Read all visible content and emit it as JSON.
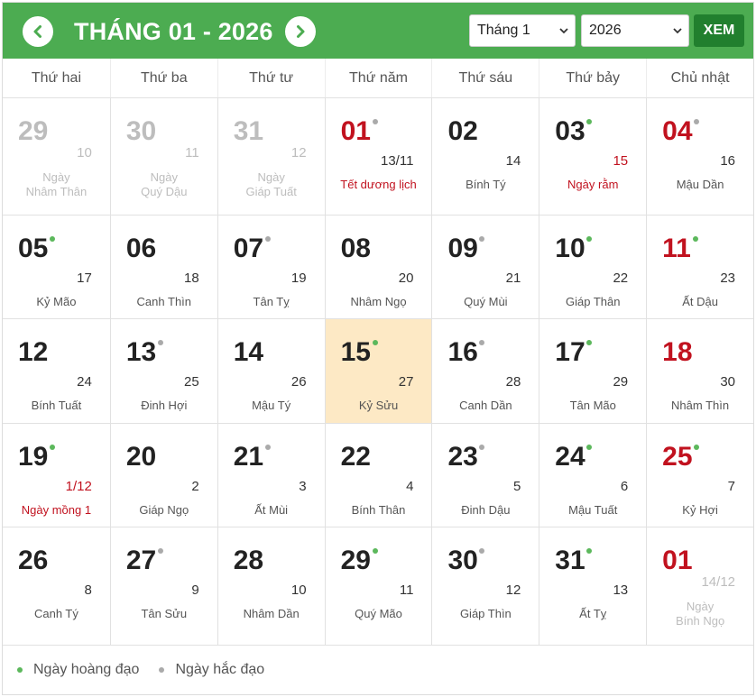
{
  "header": {
    "title": "THÁNG 01 - 2026",
    "month_select": "Tháng 1",
    "year_select": "2026",
    "view_label": "XEM",
    "accent": "#4cac51",
    "button_color": "#217f2e"
  },
  "weekdays": [
    "Thứ hai",
    "Thứ ba",
    "Thứ tư",
    "Thứ năm",
    "Thứ sáu",
    "Thứ bảy",
    "Chủ nhật"
  ],
  "weeks": [
    [
      {
        "day": "29",
        "lunar": "10",
        "canchi": "Ngày\nNhâm Thân",
        "muted": true
      },
      {
        "day": "30",
        "lunar": "11",
        "canchi": "Ngày\nQuý Dậu",
        "muted": true
      },
      {
        "day": "31",
        "lunar": "12",
        "canchi": "Ngày\nGiáp Tuất",
        "muted": true
      },
      {
        "day": "01",
        "lunar": "13/11",
        "canchi": "Tết dương lịch",
        "red_day": true,
        "red_canchi": true,
        "dot": "bad"
      },
      {
        "day": "02",
        "lunar": "14",
        "canchi": "Bính Tý"
      },
      {
        "day": "03",
        "lunar": "15",
        "canchi": "Ngày rằm",
        "red_lunar": true,
        "red_canchi": true,
        "dot": "good"
      },
      {
        "day": "04",
        "lunar": "16",
        "canchi": "Mậu Dần",
        "red_day": true,
        "dot": "bad"
      }
    ],
    [
      {
        "day": "05",
        "lunar": "17",
        "canchi": "Kỷ Mão",
        "dot": "good"
      },
      {
        "day": "06",
        "lunar": "18",
        "canchi": "Canh Thìn"
      },
      {
        "day": "07",
        "lunar": "19",
        "canchi": "Tân Tỵ",
        "dot": "bad"
      },
      {
        "day": "08",
        "lunar": "20",
        "canchi": "Nhâm Ngọ"
      },
      {
        "day": "09",
        "lunar": "21",
        "canchi": "Quý Mùi",
        "dot": "bad"
      },
      {
        "day": "10",
        "lunar": "22",
        "canchi": "Giáp Thân",
        "dot": "good"
      },
      {
        "day": "11",
        "lunar": "23",
        "canchi": "Ất Dậu",
        "red_day": true,
        "dot": "good"
      }
    ],
    [
      {
        "day": "12",
        "lunar": "24",
        "canchi": "Bính Tuất"
      },
      {
        "day": "13",
        "lunar": "25",
        "canchi": "Đinh Hợi",
        "dot": "bad"
      },
      {
        "day": "14",
        "lunar": "26",
        "canchi": "Mậu Tý"
      },
      {
        "day": "15",
        "lunar": "27",
        "canchi": "Kỷ Sửu",
        "dot": "good",
        "today": true
      },
      {
        "day": "16",
        "lunar": "28",
        "canchi": "Canh Dần",
        "dot": "bad"
      },
      {
        "day": "17",
        "lunar": "29",
        "canchi": "Tân Mão",
        "dot": "good"
      },
      {
        "day": "18",
        "lunar": "30",
        "canchi": "Nhâm Thìn",
        "red_day": true
      }
    ],
    [
      {
        "day": "19",
        "lunar": "1/12",
        "canchi": "Ngày mồng 1",
        "red_lunar": true,
        "red_canchi": true,
        "dot": "good"
      },
      {
        "day": "20",
        "lunar": "2",
        "canchi": "Giáp Ngọ"
      },
      {
        "day": "21",
        "lunar": "3",
        "canchi": "Ất Mùi",
        "dot": "bad"
      },
      {
        "day": "22",
        "lunar": "4",
        "canchi": "Bính Thân"
      },
      {
        "day": "23",
        "lunar": "5",
        "canchi": "Đinh Dậu",
        "dot": "bad"
      },
      {
        "day": "24",
        "lunar": "6",
        "canchi": "Mậu Tuất",
        "dot": "good"
      },
      {
        "day": "25",
        "lunar": "7",
        "canchi": "Kỷ Hợi",
        "red_day": true,
        "dot": "good"
      }
    ],
    [
      {
        "day": "26",
        "lunar": "8",
        "canchi": "Canh Tý"
      },
      {
        "day": "27",
        "lunar": "9",
        "canchi": "Tân Sửu",
        "dot": "bad"
      },
      {
        "day": "28",
        "lunar": "10",
        "canchi": "Nhâm Dần"
      },
      {
        "day": "29",
        "lunar": "11",
        "canchi": "Quý Mão",
        "dot": "good"
      },
      {
        "day": "30",
        "lunar": "12",
        "canchi": "Giáp Thìn",
        "dot": "bad"
      },
      {
        "day": "31",
        "lunar": "13",
        "canchi": "Ất Tỵ",
        "dot": "good"
      },
      {
        "day": "01",
        "lunar": "14/12",
        "canchi": "Ngày\nBính Ngọ",
        "red_day": true,
        "muted_lunar": true,
        "muted_canchi": true
      }
    ]
  ],
  "legend": {
    "good_label": "Ngày hoàng đạo",
    "bad_label": "Ngày hắc đạo",
    "good_color": "#5cb85c",
    "bad_color": "#aaaaaa"
  }
}
